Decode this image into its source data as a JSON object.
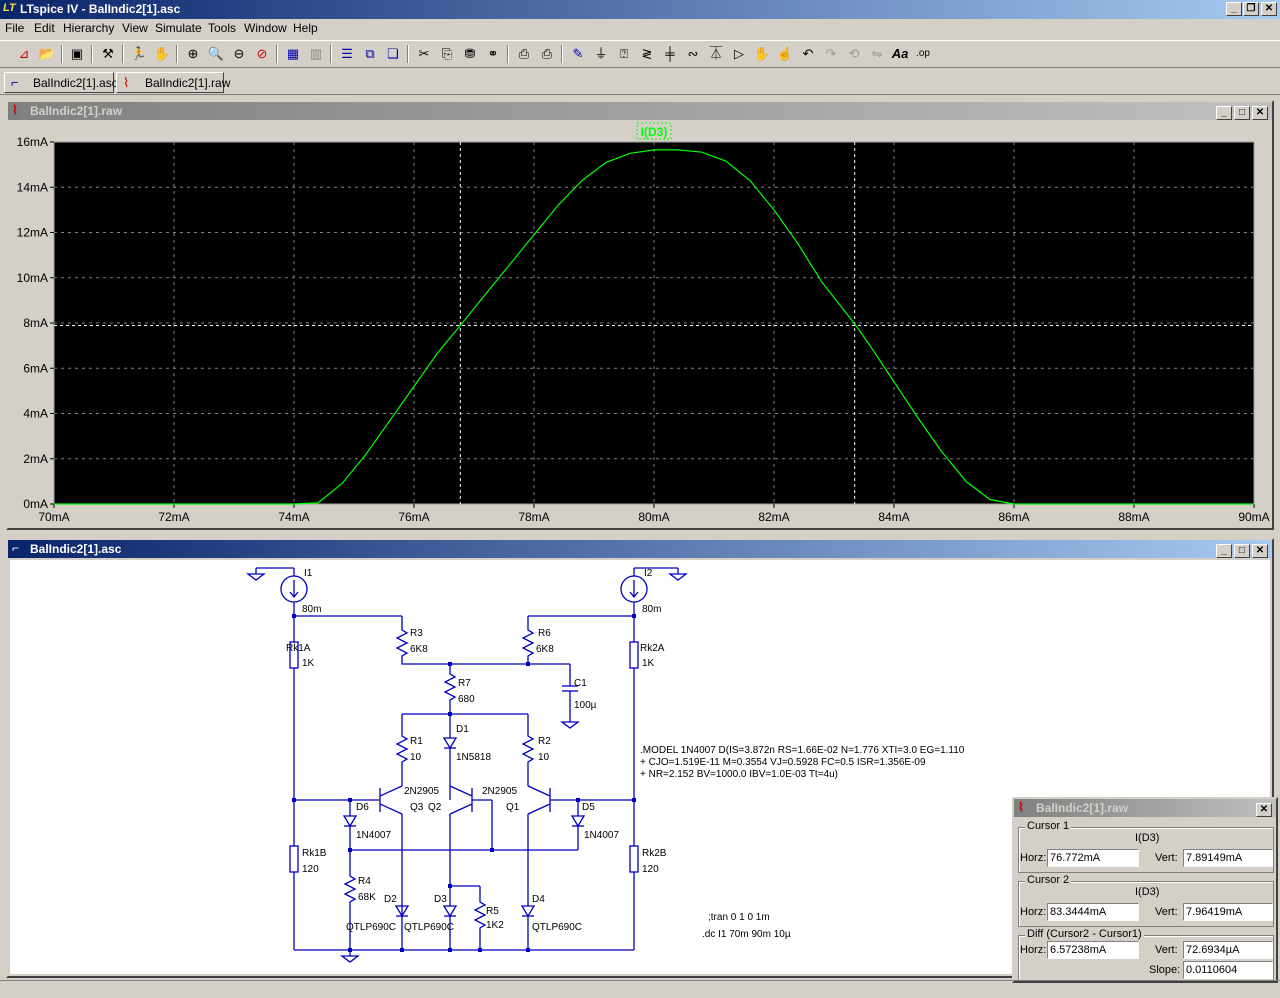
{
  "app": {
    "title": "LTspice IV - BalIndic2[1].asc",
    "logo": "LT"
  },
  "menu": [
    "File",
    "Edit",
    "Hierarchy",
    "View",
    "Simulate",
    "Tools",
    "Window",
    "Help"
  ],
  "tabs": [
    {
      "label": "BalIndic2[1].asc",
      "icon": "schematic-icon"
    },
    {
      "label": "BalIndic2[1].raw",
      "icon": "waveform-icon"
    }
  ],
  "toolbar_icons": [
    "new-schematic",
    "open",
    "save",
    "control-panel",
    "run",
    "halt",
    "zoom-in",
    "zoom-pan",
    "zoom-out",
    "zoom-cancel",
    "autorange",
    "auto-y",
    "tile-h",
    "tile-v",
    "cascade",
    "cut",
    "copy",
    "find",
    "binoculars",
    "print-setup",
    "print",
    "wire",
    "ground",
    "label",
    "resistor",
    "capacitor",
    "inductor",
    "diode",
    "component",
    "move",
    "drag",
    "undo",
    "redo",
    "rotate",
    "mirror",
    "text",
    "spice-directive"
  ],
  "plot_window": {
    "title": "BalIndic2[1].raw",
    "trace_label": "I(D3)",
    "colors": {
      "bg": "#000000",
      "trace": "#00ff00",
      "grid": "#808080",
      "label_bg": "#00ff00"
    }
  },
  "chart_data": {
    "type": "line",
    "title": "",
    "xlabel": "",
    "ylabel": "",
    "xlim": [
      70,
      90
    ],
    "ylim": [
      0,
      16
    ],
    "x_ticks": [
      "70mA",
      "72mA",
      "74mA",
      "76mA",
      "78mA",
      "80mA",
      "82mA",
      "84mA",
      "86mA",
      "88mA",
      "90mA"
    ],
    "y_ticks": [
      "0mA",
      "2mA",
      "4mA",
      "6mA",
      "8mA",
      "10mA",
      "12mA",
      "14mA",
      "16mA"
    ],
    "grid": true,
    "series": [
      {
        "name": "I(D3)",
        "x": [
          70,
          74.0,
          74.4,
          74.8,
          75.2,
          75.6,
          76.0,
          76.4,
          76.772,
          77.2,
          77.6,
          78.0,
          78.4,
          78.8,
          79.2,
          79.6,
          80.0,
          80.4,
          80.8,
          81.2,
          81.6,
          82.0,
          82.4,
          82.8,
          83.3444,
          83.6,
          84.0,
          84.4,
          84.8,
          85.2,
          85.6,
          86.0,
          90
        ],
        "y": [
          0,
          0,
          0.05,
          0.9,
          2.2,
          3.7,
          5.2,
          6.7,
          7.89,
          9.3,
          10.6,
          11.9,
          13.2,
          14.3,
          15.1,
          15.5,
          15.65,
          15.65,
          15.55,
          15.15,
          14.3,
          13.0,
          11.5,
          9.8,
          7.96,
          7.0,
          5.4,
          3.8,
          2.3,
          1.0,
          0.2,
          0,
          0
        ]
      }
    ],
    "cursors": [
      {
        "x": 76.772,
        "y": 7.89149
      },
      {
        "x": 83.3444,
        "y": 7.96419
      }
    ]
  },
  "schematic_window": {
    "title": "BalIndic2[1].asc",
    "labels": {
      "I1": "I1",
      "I2": "I2",
      "I1_val": "80m",
      "I2_val": "80m",
      "Rk1A": "Rk1A",
      "Rk1A_val": "1K",
      "Rk2A": "Rk2A",
      "Rk2A_val": "1K",
      "R3": "R3",
      "R3_val": "6K8",
      "R6": "R6",
      "R6_val": "6K8",
      "C1": "C1",
      "C1_val": "100µ",
      "R7": "R7",
      "R7_val": "680",
      "D1": "D1",
      "D1_val": "1N5818",
      "R1": "R1",
      "R1_val": "10",
      "R2": "R2",
      "R2_val": "10",
      "Q3": "Q3",
      "Q2": "Q2",
      "Q1": "Q1",
      "Q32_type": "2N2905",
      "Q1_type": "2N2905",
      "D6": "D6",
      "D6_val": "1N4007",
      "D5": "D5",
      "D5_val": "1N4007",
      "Rk1B": "Rk1B",
      "Rk1B_val": "120",
      "Rk2B": "Rk2B",
      "Rk2B_val": "120",
      "R4": "R4",
      "R4_val": "68K",
      "D2": "D2",
      "D3": "D3",
      "D4": "D4",
      "D2_val": "QTLP690C",
      "D3_val": "QTLP690C",
      "D4_val": "QTLP690C",
      "R5": "R5",
      "R5_val": "1K2",
      "model_line1": ".MODEL  1N4007  D(IS=3.872n RS=1.66E-02 N=1.776 XTI=3.0 EG=1.110",
      "model_line2": "+ CJO=1.519E-11 M=0.3554 VJ=0.5928 FC=0.5 ISR=1.356E-09",
      "model_line3": "+ NR=2.152 BV=1000.0 IBV=1.0E-03 Tt=4u)",
      "tran": ";tran 0 1 0 1m",
      "dc": ".dc I1 70m 90m 10µ"
    }
  },
  "cursor_window": {
    "title": "BalIndic2[1].raw",
    "cursor1": {
      "group": "Cursor 1",
      "trace": "I(D3)",
      "horz_label": "Horz:",
      "horz": "76.772mA",
      "vert_label": "Vert:",
      "vert": "7.89149mA"
    },
    "cursor2": {
      "group": "Cursor 2",
      "trace": "I(D3)",
      "horz_label": "Horz:",
      "horz": "83.3444mA",
      "vert_label": "Vert:",
      "vert": "7.96419mA"
    },
    "diff": {
      "group": "Diff (Cursor2 - Cursor1)",
      "horz_label": "Horz:",
      "horz": "6.57238mA",
      "vert_label": "Vert:",
      "vert": "72.6934µA",
      "slope_label": "Slope:",
      "slope": "0.0110604"
    }
  }
}
